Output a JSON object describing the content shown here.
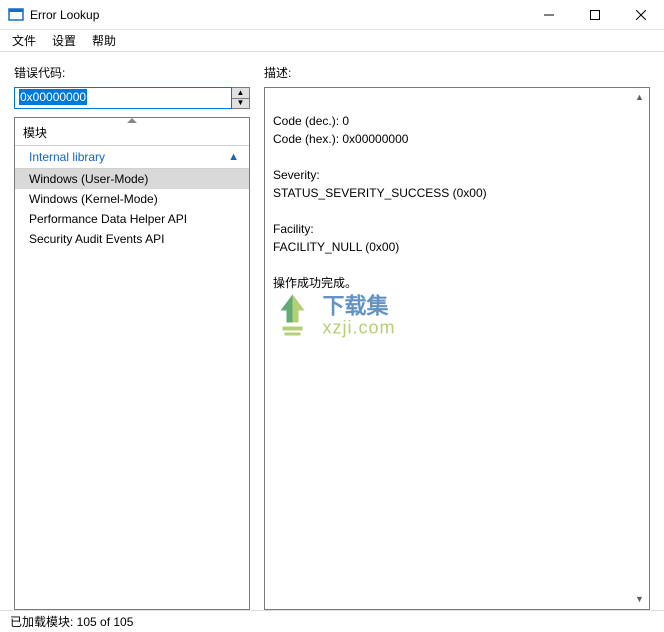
{
  "window": {
    "title": "Error Lookup"
  },
  "menu": {
    "file": "文件",
    "settings": "设置",
    "help": "帮助"
  },
  "labels": {
    "error_code": "错误代码:",
    "module": "模块",
    "description": "描述:"
  },
  "input": {
    "value": "0x00000000"
  },
  "modules": {
    "group_label": "Internal library",
    "items": [
      "Windows (User-Mode)",
      "Windows (Kernel-Mode)",
      "Performance Data Helper API",
      "Security Audit Events API"
    ],
    "selected_index": 0
  },
  "description": {
    "code_dec": "Code (dec.): 0",
    "code_hex": "Code (hex.): 0x00000000",
    "severity_label": "Severity:",
    "severity_value": "STATUS_SEVERITY_SUCCESS (0x00)",
    "facility_label": "Facility:",
    "facility_value": "FACILITY_NULL (0x00)",
    "message": "操作成功完成。"
  },
  "watermark": {
    "line1": "下载集",
    "line2": "xzji.com"
  },
  "status": {
    "text": "已加载模块: 105 of 105"
  }
}
